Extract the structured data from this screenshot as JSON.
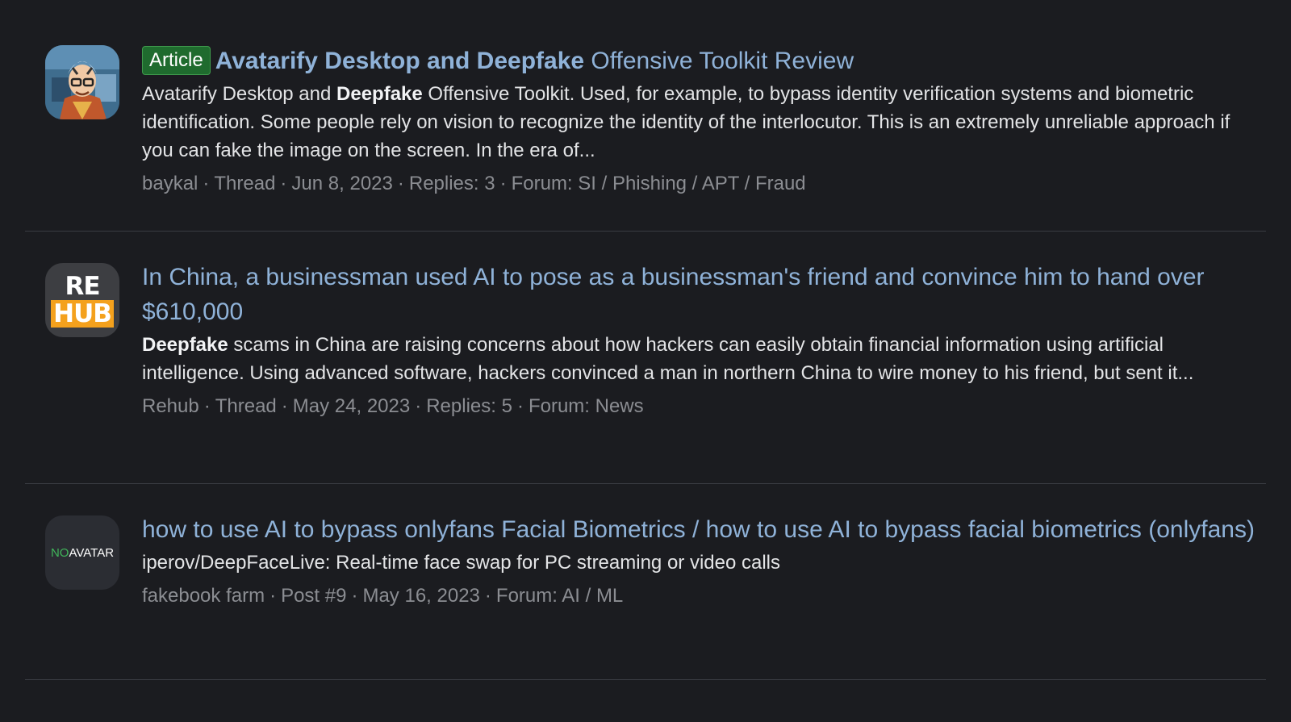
{
  "results": [
    {
      "badge": "Article",
      "title_highlight": "Avatarify Desktop and Deepfake",
      "title_rest": " Offensive Toolkit Review",
      "snippet_pre": "Avatarify Desktop and ",
      "snippet_bold": "Deepfake",
      "snippet_post": " Offensive Toolkit. Used, for example, to bypass identity verification systems and biometric identification. Some people rely on vision to recognize the identity of the interlocutor. This is an extremely unreliable approach if you can fake the image on the screen. In the era of...",
      "author": "baykal",
      "type": "Thread",
      "date": "Jun 8, 2023",
      "replies": "Replies: 3",
      "forum": "Forum: SI / Phishing / APT / Fraud",
      "avatar_icon": "cartoon-avatar-icon"
    },
    {
      "title": "In China, a businessman used AI to pose as a businessman's friend and convince him to hand over $610,000",
      "snippet_bold": "Deepfake",
      "snippet_post": " scams in China are raising concerns about how hackers can easily obtain financial information using artificial intelligence. Using advanced software, hackers convinced a man in northern China to wire money to his friend, but sent it...",
      "author": "Rehub",
      "type": "Thread",
      "date": "May 24, 2023",
      "replies": "Replies: 5",
      "forum": "Forum: News",
      "avatar_top": "RE",
      "avatar_bottom": "HUB"
    },
    {
      "title": "how to use AI to bypass onlyfans Facial Biometrics / how to use AI to bypass facial biometrics (onlyfans)",
      "snippet": "iperov/DeepFaceLive: Real-time face swap for PC streaming or video calls",
      "author": "fakebook farm",
      "type": "Post #9",
      "date": "May 16, 2023",
      "forum": "Forum: AI / ML",
      "avatar_no": "NO",
      "avatar_text": "AVATAR"
    }
  ],
  "separator": "·",
  "colors": {
    "background": "#1b1c20",
    "link": "#8fb2d8",
    "badge_bg": "#1f6b2e",
    "meta": "#8b8d92",
    "hub_orange": "#f4a11d"
  }
}
